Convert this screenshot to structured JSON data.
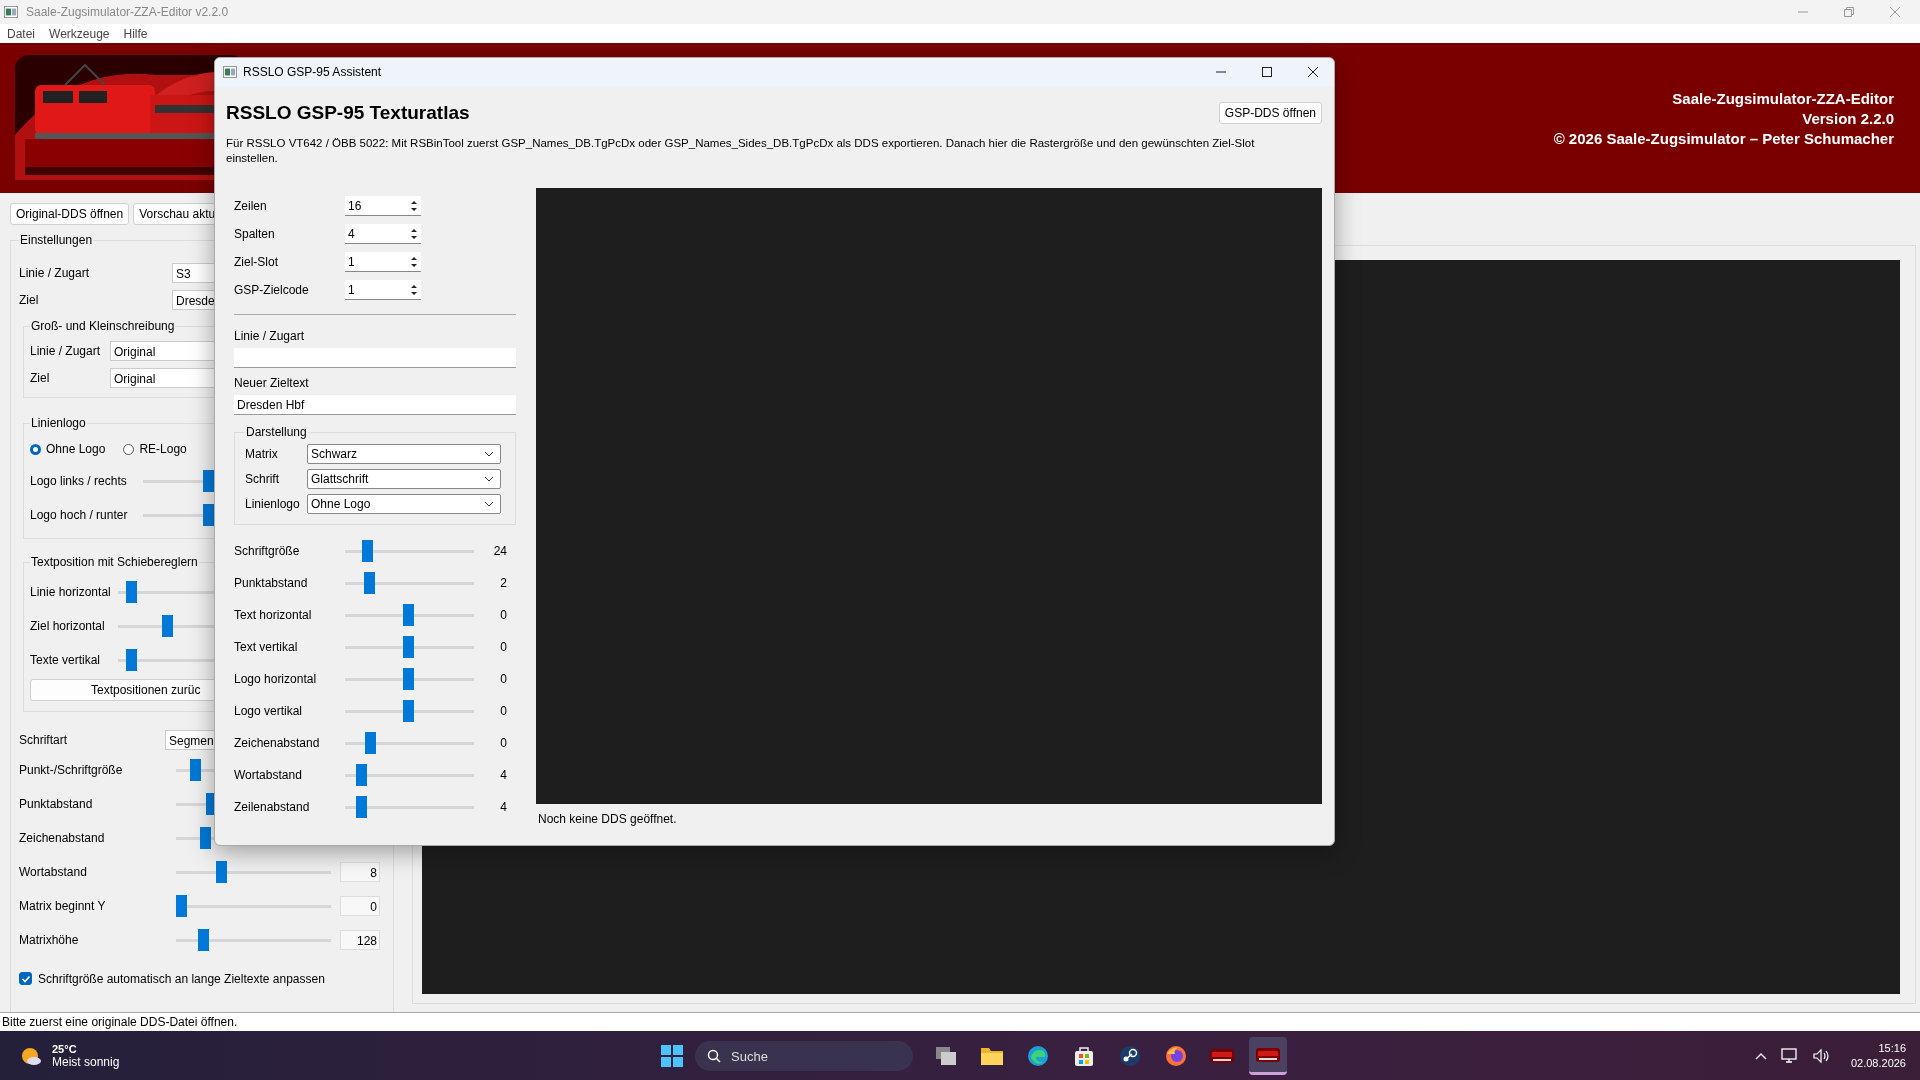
{
  "app": {
    "title": "Saale-Zugsimulator-ZZA-Editor v2.2.0",
    "menu": [
      "Datei",
      "Werkzeuge",
      "Hilfe"
    ]
  },
  "banner": {
    "lines": [
      "Saale-Zugsimulator-ZZA-Editor",
      "Version 2.2.0",
      "© 2026 Saale-Zugsimulator – Peter Schumacher"
    ]
  },
  "toolbar": [
    "Original-DDS öffnen",
    "Vorschau aktu"
  ],
  "settings": {
    "title": "Einstellungen",
    "fields": [
      {
        "label": "Linie / Zugart",
        "value": "S3"
      },
      {
        "label": "Ziel",
        "value": "Dresde"
      }
    ],
    "case_group": {
      "title": "Groß- und Kleinschreibung",
      "fields": [
        {
          "label": "Linie / Zugart",
          "value": "Original"
        },
        {
          "label": "Ziel",
          "value": "Original"
        }
      ]
    },
    "logo_group": {
      "title": "Linienlogo",
      "radios": [
        {
          "label": "Ohne Logo",
          "selected": true
        },
        {
          "label": "RE-Logo",
          "selected": false
        }
      ],
      "sliders": [
        {
          "label": "Logo links / rechts",
          "level": 0.5
        },
        {
          "label": "Logo hoch / runter",
          "level": 0.5
        }
      ]
    },
    "text_position": {
      "title": "Textposition mit Schiebereglern",
      "sliders": [
        {
          "label": "Linie horizontal",
          "level": 0.05
        },
        {
          "label": "Ziel horizontal",
          "level": 0.27
        },
        {
          "label": "Texte vertikal",
          "level": 0.05
        }
      ],
      "reset_button": "Textpositionen zurüc"
    },
    "font": {
      "label": "Schriftart",
      "value": "Segmen"
    },
    "sliders": [
      {
        "label": "Punkt-/Schriftgröße",
        "level": 0.1
      },
      {
        "label": "Punktabstand",
        "level": 0.21
      },
      {
        "label": "Zeichenabstand",
        "level": 0.17
      },
      {
        "label": "Wortabstand",
        "level": 0.28,
        "reading": "8"
      },
      {
        "label": "Matrix beginnt Y",
        "level": 0,
        "reading": "0"
      },
      {
        "label": "Matrixhöhe",
        "level": 0.15,
        "reading": "128"
      }
    ],
    "auto_size": {
      "label": "Schriftgröße automatisch an lange Zieltexte anpassen",
      "checked": true
    }
  },
  "status_bar": "Bitte zuerst eine originale DDS-Datei öffnen.",
  "dialog": {
    "title": "RSSLO GSP-95 Assistent",
    "heading": "RSSLO GSP-95 Texturatlas",
    "open_button": "GSP-DDS öffnen",
    "description": "Für RSSLO VT642 / ÖBB 5022: Mit RSBinTool zuerst GSP_Names_DB.TgPcDx oder GSP_Names_Sides_DB.TgPcDx als DDS exportieren. Danach hier die Rastergröße und den gewünschten Ziel-Slot einstellen.",
    "spinners": [
      {
        "label": "Zeilen",
        "value": "16"
      },
      {
        "label": "Spalten",
        "value": "4"
      },
      {
        "label": "Ziel-Slot",
        "value": "1"
      },
      {
        "label": "GSP-Zielcode",
        "value": "1"
      }
    ],
    "line_label": "Linie / Zugart",
    "dest_label": "Neuer Zieltext",
    "dest_value": "Dresden Hbf",
    "display_group": {
      "title": "Darstellung",
      "combos": [
        {
          "label": "Matrix",
          "value": "Schwarz"
        },
        {
          "label": "Schrift",
          "value": "Glattschrift"
        },
        {
          "label": "Linienlogo",
          "value": "Ohne Logo"
        }
      ]
    },
    "sliders": [
      {
        "label": "Schriftgröße",
        "level": 0.14,
        "reading": "24"
      },
      {
        "label": "Punktabstand",
        "level": 0.16,
        "reading": "2"
      },
      {
        "label": "Text horizontal",
        "level": 0.49,
        "reading": "0"
      },
      {
        "label": "Text vertikal",
        "level": 0.49,
        "reading": "0"
      },
      {
        "label": "Logo horizontal",
        "level": 0.49,
        "reading": "0"
      },
      {
        "label": "Logo vertikal",
        "level": 0.49,
        "reading": "0"
      },
      {
        "label": "Zeichenabstand",
        "level": 0.17,
        "reading": "0"
      },
      {
        "label": "Wortabstand",
        "level": 0.09,
        "reading": "4"
      },
      {
        "label": "Zeilenabstand",
        "level": 0.09,
        "reading": "4"
      }
    ],
    "preview_status": "Noch keine DDS geöffnet."
  },
  "taskbar": {
    "weather": {
      "temperature": "25°C",
      "text": "Meist sonnig"
    },
    "search_placeholder": "Suche",
    "apps": [
      {
        "kind": "taskview",
        "selected": false
      },
      {
        "kind": "folder",
        "selected": false
      },
      {
        "kind": "edge",
        "selected": false
      },
      {
        "kind": "store",
        "selected": false
      },
      {
        "kind": "steam",
        "selected": false
      },
      {
        "kind": "firefox",
        "selected": false
      },
      {
        "kind": "train",
        "selected": false
      },
      {
        "kind": "train",
        "selected": true
      }
    ],
    "time": "15:16",
    "date": "02.08.2026"
  }
}
